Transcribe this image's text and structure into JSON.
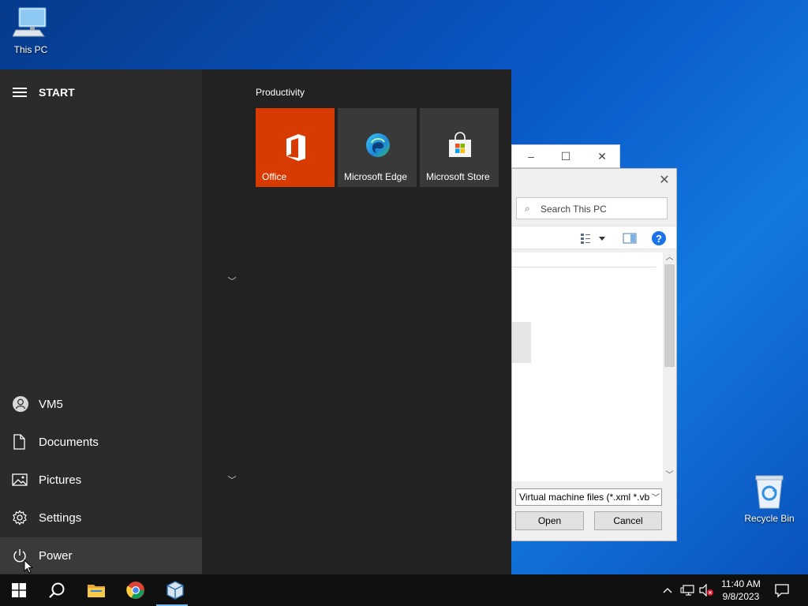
{
  "desktop": {
    "icons": [
      {
        "label": "This PC",
        "icon": "computer-icon"
      },
      {
        "label": "Recycle Bin",
        "icon": "recycle-bin-icon"
      }
    ]
  },
  "dialog": {
    "search_placeholder": "Search This PC",
    "filter_value": "Virtual machine files (*.xml *.vb",
    "open_label": "Open",
    "cancel_label": "Cancel"
  },
  "start": {
    "header": "START",
    "group_title": "Productivity",
    "nav": {
      "user": "VM5",
      "documents": "Documents",
      "pictures": "Pictures",
      "settings": "Settings",
      "power": "Power"
    },
    "tiles": [
      {
        "label": "Office",
        "color": "#d83b01",
        "icon": "office-icon"
      },
      {
        "label": "Microsoft Edge",
        "color": "#393939",
        "icon": "edge-icon"
      },
      {
        "label": "Microsoft Store",
        "color": "#393939",
        "icon": "store-icon"
      }
    ]
  },
  "taskbar": {
    "apps": [
      "start-windows-icon",
      "search-icon",
      "file-explorer-icon",
      "chrome-icon",
      "virtualbox-icon"
    ],
    "time": "11:40 AM",
    "date": "9/8/2023"
  },
  "colors": {
    "accent": "#0078d7",
    "office_tile": "#d83b01",
    "help_blue": "#1a73e8"
  }
}
